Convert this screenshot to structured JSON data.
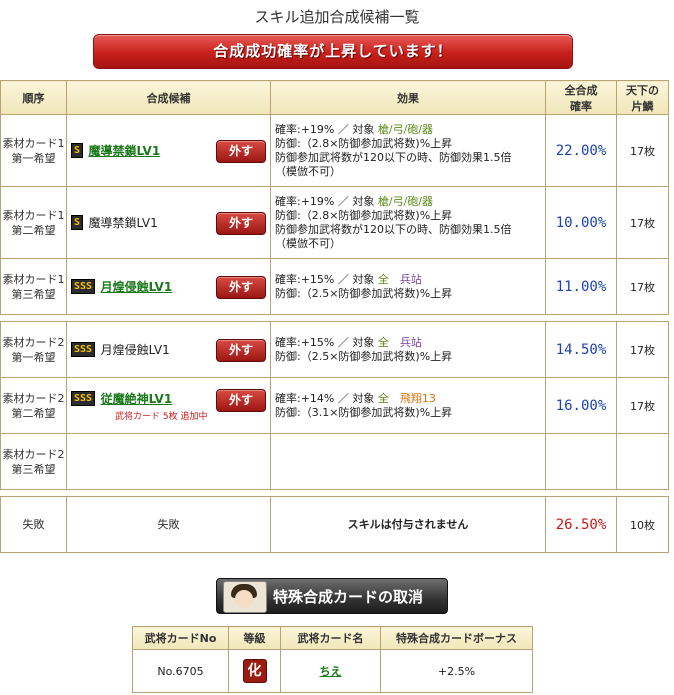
{
  "page_title": "スキル追加合成候補一覧",
  "banner": "合成成功確率が上昇しています！",
  "headers": {
    "order": "順序",
    "candidate": "合成候補",
    "effect": "効果",
    "rate": "全合成確率",
    "count": "天下の片鱗"
  },
  "rows": [
    {
      "order1": "素材カード1",
      "order2": "第一希望",
      "rank": "S",
      "skill": "魔導禁鎖LV1",
      "remove": "外す",
      "eff1a": "確率:+19% ／ 対象 ",
      "eff1b": "槍/弓/砲/器",
      "eff2": "防御:（2.8×防御参加武将数)%上昇",
      "eff3": "防御参加武将数が120以下の時、防御効果1.5倍",
      "eff4": "（模倣不可）",
      "rate": "22.00%",
      "count": "17枚"
    },
    {
      "order1": "素材カード1",
      "order2": "第二希望",
      "rank": "S",
      "skill": "魔導禁鎖LV1",
      "remove": "外す",
      "eff1a": "確率:+19% ／ 対象 ",
      "eff1b": "槍/弓/砲/器",
      "eff2": "防御:（2.8×防御参加武将数)%上昇",
      "eff3": "防御参加武将数が120以下の時、防御効果1.5倍",
      "eff4": "（模倣不可）",
      "rate": "10.00%",
      "count": "17枚"
    },
    {
      "order1": "素材カード1",
      "order2": "第三希望",
      "rank": "SSS",
      "skill": "月煌侵蝕LV1",
      "remove": "外す",
      "eff1a": "確率:+15% ／ 対象 ",
      "eff1b": "全",
      "eff1c": "兵站",
      "eff2": "防御:（2.5×防御参加武将数)%上昇",
      "rate": "11.00%",
      "count": "17枚"
    },
    {
      "order1": "素材カード2",
      "order2": "第一希望",
      "rank": "SSS",
      "skill": "月煌侵蝕LV1",
      "remove": "外す",
      "eff1a": "確率:+15% ／ 対象 ",
      "eff1b": "全",
      "eff1c": "兵站",
      "eff2": "防御:（2.5×防御参加武将数)%上昇",
      "rate": "14.50%",
      "count": "17枚"
    },
    {
      "order1": "素材カード2",
      "order2": "第二希望",
      "rank": "SSS",
      "skill": "従魔絶神LV1",
      "remove": "外す",
      "note": "武将カード 5枚 追加中",
      "eff1a": "確率:+14% ／ 対象 ",
      "eff1b": "全",
      "eff1c": "飛翔13",
      "eff2": "防御:（3.1×防御参加武将数)%上昇",
      "rate": "16.00%",
      "count": "17枚"
    },
    {
      "order1": "素材カード2",
      "order2": "第三希望"
    }
  ],
  "fail_row": {
    "order": "失敗",
    "candidate": "失敗",
    "effect": "スキルは付与されません",
    "rate": "26.50%",
    "count": "10枚"
  },
  "cancel_button": "特殊合成カードの取消",
  "sub_table": {
    "headers": {
      "no": "武将カードNo",
      "grade": "等級",
      "name": "武将カード名",
      "bonus": "特殊合成カードボーナス"
    },
    "no": "No.6705",
    "grade": "化",
    "name": "ちえ",
    "bonus": "+2.5%"
  },
  "colors": {
    "accent_red": "#c8201c",
    "rate_blue": "#1a3fb8",
    "rate_red": "#c81818",
    "link_green": "#1a7a1a"
  }
}
